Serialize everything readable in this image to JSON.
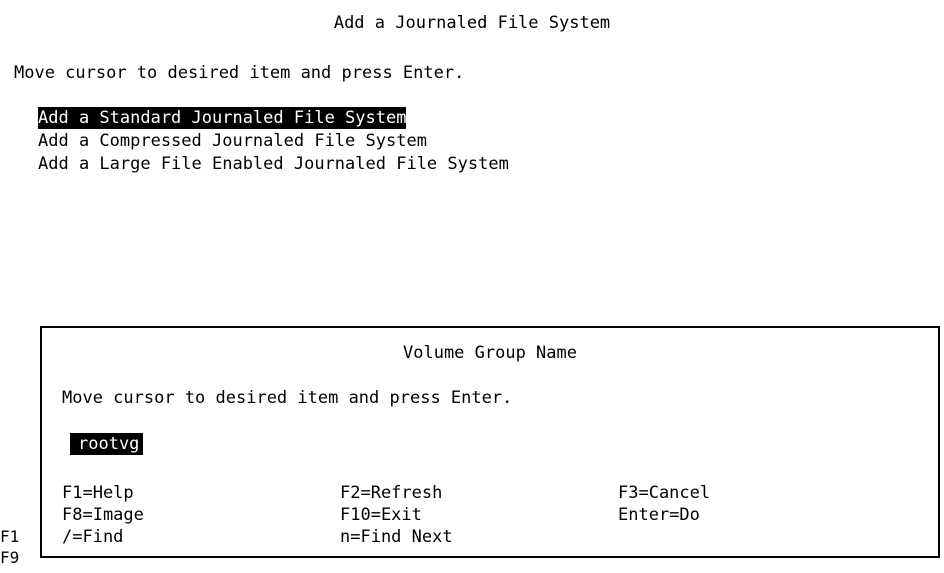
{
  "screen": {
    "title": "Add a Journaled File System",
    "instruction": "Move cursor to desired item and press Enter.",
    "menu_items": [
      "Add a Standard Journaled File System",
      "Add a Compressed Journaled File System",
      "Add a Large File Enabled Journaled File System"
    ],
    "selected_index": 0,
    "partial_function_keys": [
      "F1",
      "F9"
    ]
  },
  "popup": {
    "title": "Volume Group Name",
    "instruction": "Move cursor to desired item and press Enter.",
    "items": [
      "rootvg"
    ],
    "function_keys": [
      "F1=Help",
      "F2=Refresh",
      "F3=Cancel",
      "F8=Image",
      "F10=Exit",
      "Enter=Do",
      "/=Find",
      "n=Find Next"
    ]
  },
  "colors": {
    "background": "#ffffff",
    "foreground": "#000000",
    "highlight_bg": "#000000",
    "highlight_fg": "#ffffff"
  }
}
